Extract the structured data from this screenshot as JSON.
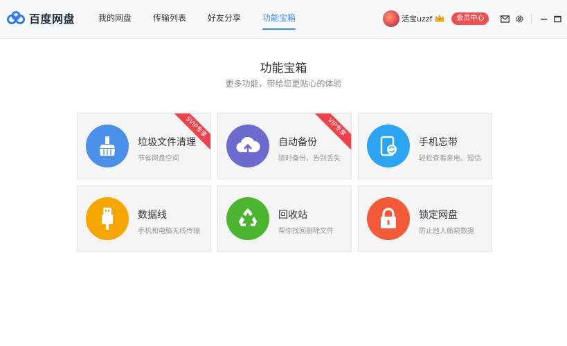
{
  "app": {
    "logo_text": "百度网盘"
  },
  "nav": [
    {
      "label": "我的网盘",
      "active": false
    },
    {
      "label": "传输列表",
      "active": false
    },
    {
      "label": "好友分享",
      "active": false
    },
    {
      "label": "功能宝箱",
      "active": true
    }
  ],
  "user": {
    "name": "活宝uzzf",
    "vip_button": "会员中心"
  },
  "page": {
    "title": "功能宝箱",
    "subtitle": "更多功能，带给您更贴心的体验"
  },
  "tools": [
    {
      "name": "垃圾文件清理",
      "desc": "节省网盘空间",
      "badge": "SVIP专享",
      "color": "#4a90e8",
      "icon": "broom-icon"
    },
    {
      "name": "自动备份",
      "desc": "随时备份，告别丢失",
      "badge": "VIP专享",
      "color": "#6b6bd0",
      "icon": "cloud-upload-icon"
    },
    {
      "name": "手机忘带",
      "desc": "轻松查看来电、短信",
      "badge": "",
      "color": "#2ba4f2",
      "icon": "phone-sync-icon"
    },
    {
      "name": "数据线",
      "desc": "手机和电脑无线传输",
      "badge": "",
      "color": "#f5a700",
      "icon": "usb-cable-icon"
    },
    {
      "name": "回收站",
      "desc": "帮你找回删除文件",
      "badge": "",
      "color": "#4cb52f",
      "icon": "recycle-icon"
    },
    {
      "name": "锁定网盘",
      "desc": "防止他人偷窥数据",
      "badge": "",
      "color": "#f35a38",
      "icon": "lock-icon"
    }
  ],
  "colors": {
    "accent": "#3b8cff",
    "vip_red": "#f04f4f",
    "ribbon_red": "#f0424a"
  }
}
